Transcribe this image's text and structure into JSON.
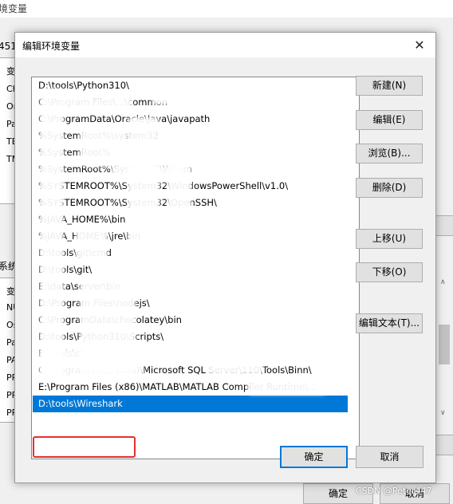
{
  "background_window": {
    "title": "境变量",
    "user_section_label": "4511",
    "user_rows": [
      "变",
      "Ch",
      "Or",
      "Pa",
      "TE",
      "TM"
    ],
    "system_section_label": "系统",
    "system_rows": [
      "变",
      "NU",
      "Os",
      "Pa",
      "PA",
      "PR",
      "PR",
      "PR"
    ],
    "ok_label": "确定",
    "cancel_label": "取消"
  },
  "dialog": {
    "title": "编辑环境变量",
    "close_glyph": "✕",
    "entries": [
      "D:\\tools\\Python310\\",
      "C:\\Program Files\\...\\common",
      "C:\\ProgramData\\Oracle\\Java\\javapath",
      "%SystemRoot%\\system32",
      "%SystemRoot%",
      "%SystemRoot%\\System32\\Wbem",
      "%SYSTEMROOT%\\System32\\WindowsPowerShell\\v1.0\\",
      "%SYSTEMROOT%\\System32\\OpenSSH\\",
      "%JAVA_HOME%\\bin",
      "%JAVA_HOME%\\jre\\bin",
      "D:\\tools\\git\\cmd",
      "D:\\tools\\git\\",
      "E:\\data\\server\\bin",
      "D:\\Program Files\\nodejs\\",
      "C:\\ProgramData\\chocolatey\\bin",
      "D:\\tools\\Python310\\Scripts\\",
      "E:\\tools\\client_11_2",
      "C:\\Program Files (x86)\\Microsoft SQL Server\\110\\Tools\\Binn\\",
      "E:\\Program Files (x86)\\MATLAB\\MATLAB Compiler Runtime\\...",
      "D:\\tools\\Wireshark"
    ],
    "selected_index": 19,
    "buttons": {
      "new": "新建(N)",
      "edit": "编辑(E)",
      "browse": "浏览(B)...",
      "delete": "删除(D)",
      "move_up": "上移(U)",
      "move_down": "下移(O)",
      "edit_text": "编辑文本(T)..."
    },
    "ok": "确定",
    "cancel": "取消"
  },
  "watermark": "CSDN @Peter447"
}
